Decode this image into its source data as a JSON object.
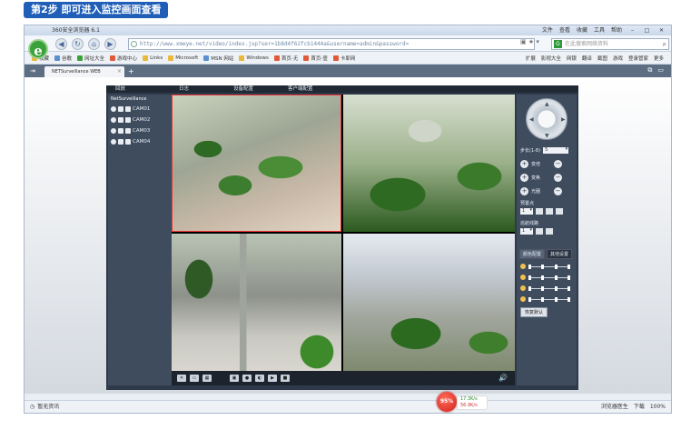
{
  "banner": {
    "text": "第2步  即可进入监控画面查看"
  },
  "browser": {
    "title": "360安全浏览器 6.1",
    "title_menu": [
      "文件",
      "查看",
      "收藏",
      "工具",
      "帮助"
    ],
    "url": "http://www.xmeye.net/video/index.jsp?ser=1b8d4f62fcb1444a&username=admin&password=",
    "search_placeholder": "在此搜索网络资料",
    "favorites": [
      "收藏",
      "谷歌",
      "网址大全",
      "游戏中心",
      "Links",
      "Microsoft",
      "MSN 网站",
      "Windows",
      "首页-无",
      "首页-壹",
      "卡耶网"
    ],
    "favorites_right": [
      "扩展",
      "影视大全",
      "网银",
      "翻译",
      "截图",
      "游戏",
      "登录管家",
      "更多"
    ],
    "tab_title": "NETSurveillance WEB",
    "status_left": "暂无资讯",
    "status_right": [
      "浏览器医生",
      "下载",
      "100%"
    ],
    "speed_ball": "95%",
    "speed_up": "17.3K/s",
    "speed_down": "56.9K/s"
  },
  "app": {
    "topnav": [
      "回放",
      "日志",
      "设备配置",
      "客户端配置"
    ],
    "tree_root": "NetSurveillance",
    "cameras": [
      "CAM01",
      "CAM02",
      "CAM03",
      "CAM04"
    ],
    "ptz": {
      "step_label": "步长(1-8)",
      "step_value": "5",
      "controls": [
        "变倍",
        "变焦",
        "光圈"
      ],
      "preset_label": "预置点",
      "preset_value": "1",
      "cruise_label": "巡航线路",
      "cruise_value": "1",
      "tab_color": "颜色配置",
      "tab_other": "其他设置",
      "default_btn": "恢复默认"
    }
  }
}
